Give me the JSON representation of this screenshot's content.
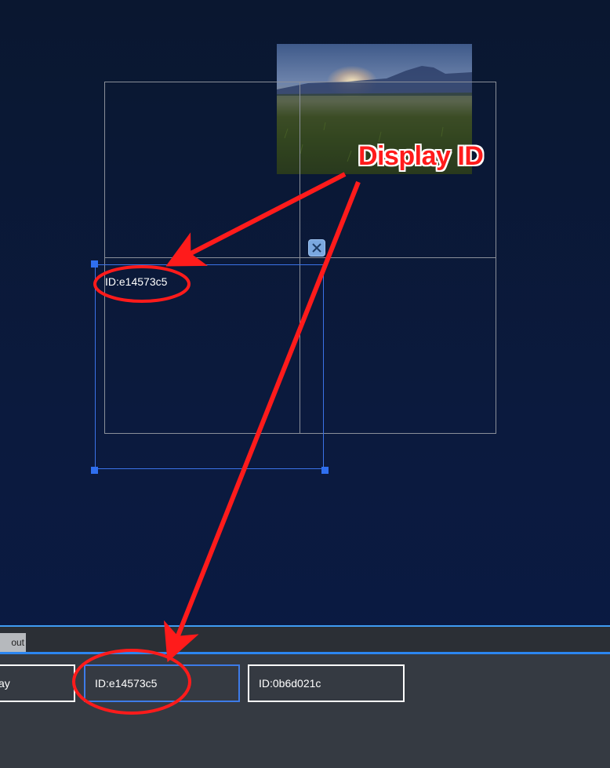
{
  "preview": {
    "image": "sunset-meadow-photo"
  },
  "selected_display": {
    "id_label": "ID:e14573c5"
  },
  "annotation": {
    "callout": "Display ID"
  },
  "bottom_panel": {
    "layout_tab_label": "out",
    "display_tabs": [
      {
        "label": "ay",
        "selected": false
      },
      {
        "label": "ID:e14573c5",
        "selected": true
      },
      {
        "label": "ID:0b6d021c",
        "selected": false
      }
    ]
  },
  "colors": {
    "background": "#0b1a3e",
    "accent": "#3b72e8",
    "annotation": "#ff1b1b",
    "panel": "#353a42"
  }
}
